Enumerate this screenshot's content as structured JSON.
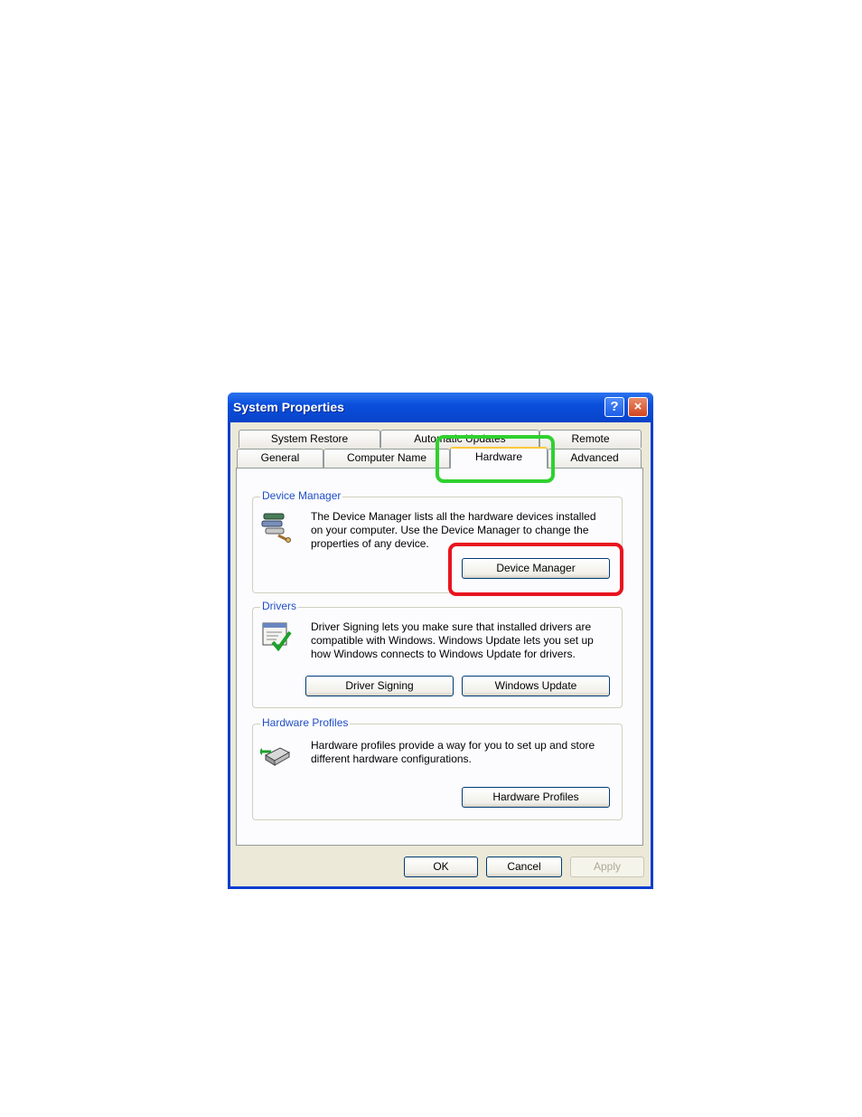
{
  "window": {
    "title": "System Properties"
  },
  "titlebar_buttons": {
    "help": "?",
    "close": "×"
  },
  "tabs": {
    "row1": [
      {
        "label": "System Restore"
      },
      {
        "label": "Automatic Updates"
      },
      {
        "label": "Remote"
      }
    ],
    "row2": [
      {
        "label": "General"
      },
      {
        "label": "Computer Name"
      },
      {
        "label": "Hardware",
        "selected": true
      },
      {
        "label": "Advanced"
      }
    ]
  },
  "device_manager": {
    "title": "Device Manager",
    "text": "The Device Manager lists all the hardware devices installed on your computer. Use the Device Manager to change the properties of any device.",
    "button": "Device Manager",
    "icon": "device-manager-icon"
  },
  "drivers": {
    "title": "Drivers",
    "text": "Driver Signing lets you make sure that installed drivers are compatible with Windows. Windows Update lets you set up how Windows connects to Windows Update for drivers.",
    "signing_button": "Driver Signing",
    "update_button": "Windows Update",
    "icon": "driver-signing-icon"
  },
  "hardware_profiles": {
    "title": "Hardware Profiles",
    "text": "Hardware profiles provide a way for you to set up and store different hardware configurations.",
    "button": "Hardware Profiles",
    "icon": "hardware-profiles-icon"
  },
  "footer": {
    "ok": "OK",
    "cancel": "Cancel",
    "apply": "Apply"
  },
  "highlight_colors": {
    "tab_highlight": "#2fd12f",
    "button_highlight": "#e8141e"
  }
}
